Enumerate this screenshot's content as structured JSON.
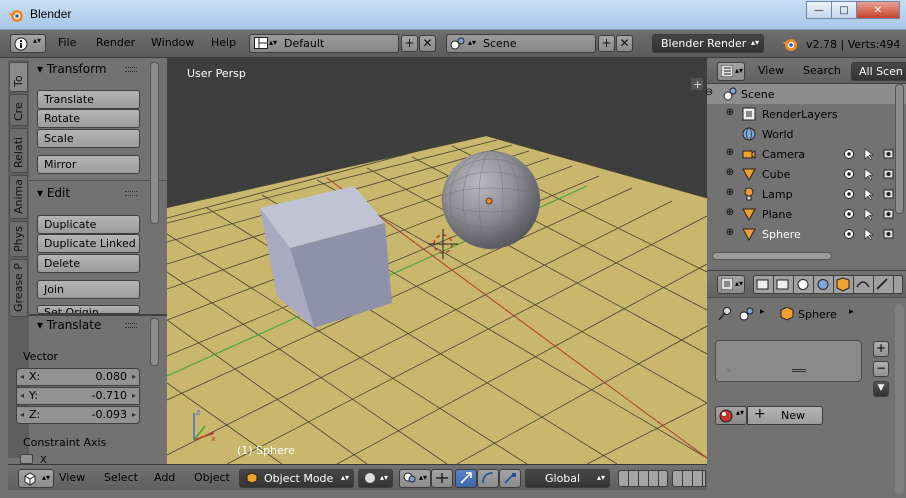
{
  "window": {
    "title": "Blender",
    "buttons": {
      "minimize": "—",
      "maximize": "□",
      "close": "✕"
    }
  },
  "header": {
    "menus": [
      "File",
      "Render",
      "Window",
      "Help"
    ],
    "layout": "Default",
    "scene": "Scene",
    "engine": "Blender Render",
    "version": "v2.78 | Verts:494"
  },
  "toolshelf": {
    "tabs": [
      "To",
      "Cre",
      "Relati",
      "Anima",
      "Phys",
      "Grease P"
    ],
    "transform_title": "Transform",
    "transform_buttons": [
      "Translate",
      "Rotate",
      "Scale"
    ],
    "mirror": "Mirror",
    "edit_title": "Edit",
    "edit_buttons": [
      "Duplicate",
      "Duplicate Linked",
      "Delete"
    ],
    "join": "Join",
    "set_origin": "Set Origin"
  },
  "operator": {
    "title": "Translate",
    "vector_label": "Vector",
    "x": {
      "label": "X:",
      "value": "0.080"
    },
    "y": {
      "label": "Y:",
      "value": "-0.710"
    },
    "z": {
      "label": "Z:",
      "value": "-0.093"
    },
    "constraint_label": "Constraint Axis",
    "constraint_x": "X"
  },
  "viewport": {
    "view_label": "User Persp",
    "object_label": "(1) Sphere"
  },
  "bottombar": {
    "menus": [
      "View",
      "Select",
      "Add",
      "Object"
    ],
    "mode": "Object Mode",
    "orientation": "Global"
  },
  "outliner": {
    "menus": [
      "View",
      "Search"
    ],
    "filter": "All Scen",
    "items": [
      {
        "name": "Scene",
        "icon": "scene-icon"
      },
      {
        "name": "RenderLayers",
        "icon": "renderlayers-icon"
      },
      {
        "name": "World",
        "icon": "world-icon"
      },
      {
        "name": "Camera",
        "icon": "camera-icon"
      },
      {
        "name": "Cube",
        "icon": "mesh-icon"
      },
      {
        "name": "Lamp",
        "icon": "lamp-icon"
      },
      {
        "name": "Plane",
        "icon": "mesh-icon"
      },
      {
        "name": "Sphere",
        "icon": "mesh-icon"
      }
    ]
  },
  "properties": {
    "object_name": "Sphere",
    "new_button": "New",
    "list_plus": "+",
    "list_minus": "−",
    "list_down": "▼"
  },
  "colors": {
    "ground": "#c8b76d",
    "grid": "#4a4330",
    "sky": "#3e3e3e",
    "cube": "#9b9cb5",
    "sphere": "#8e8e94",
    "selected_text": "#ffffff",
    "orange": "#f08a24"
  }
}
